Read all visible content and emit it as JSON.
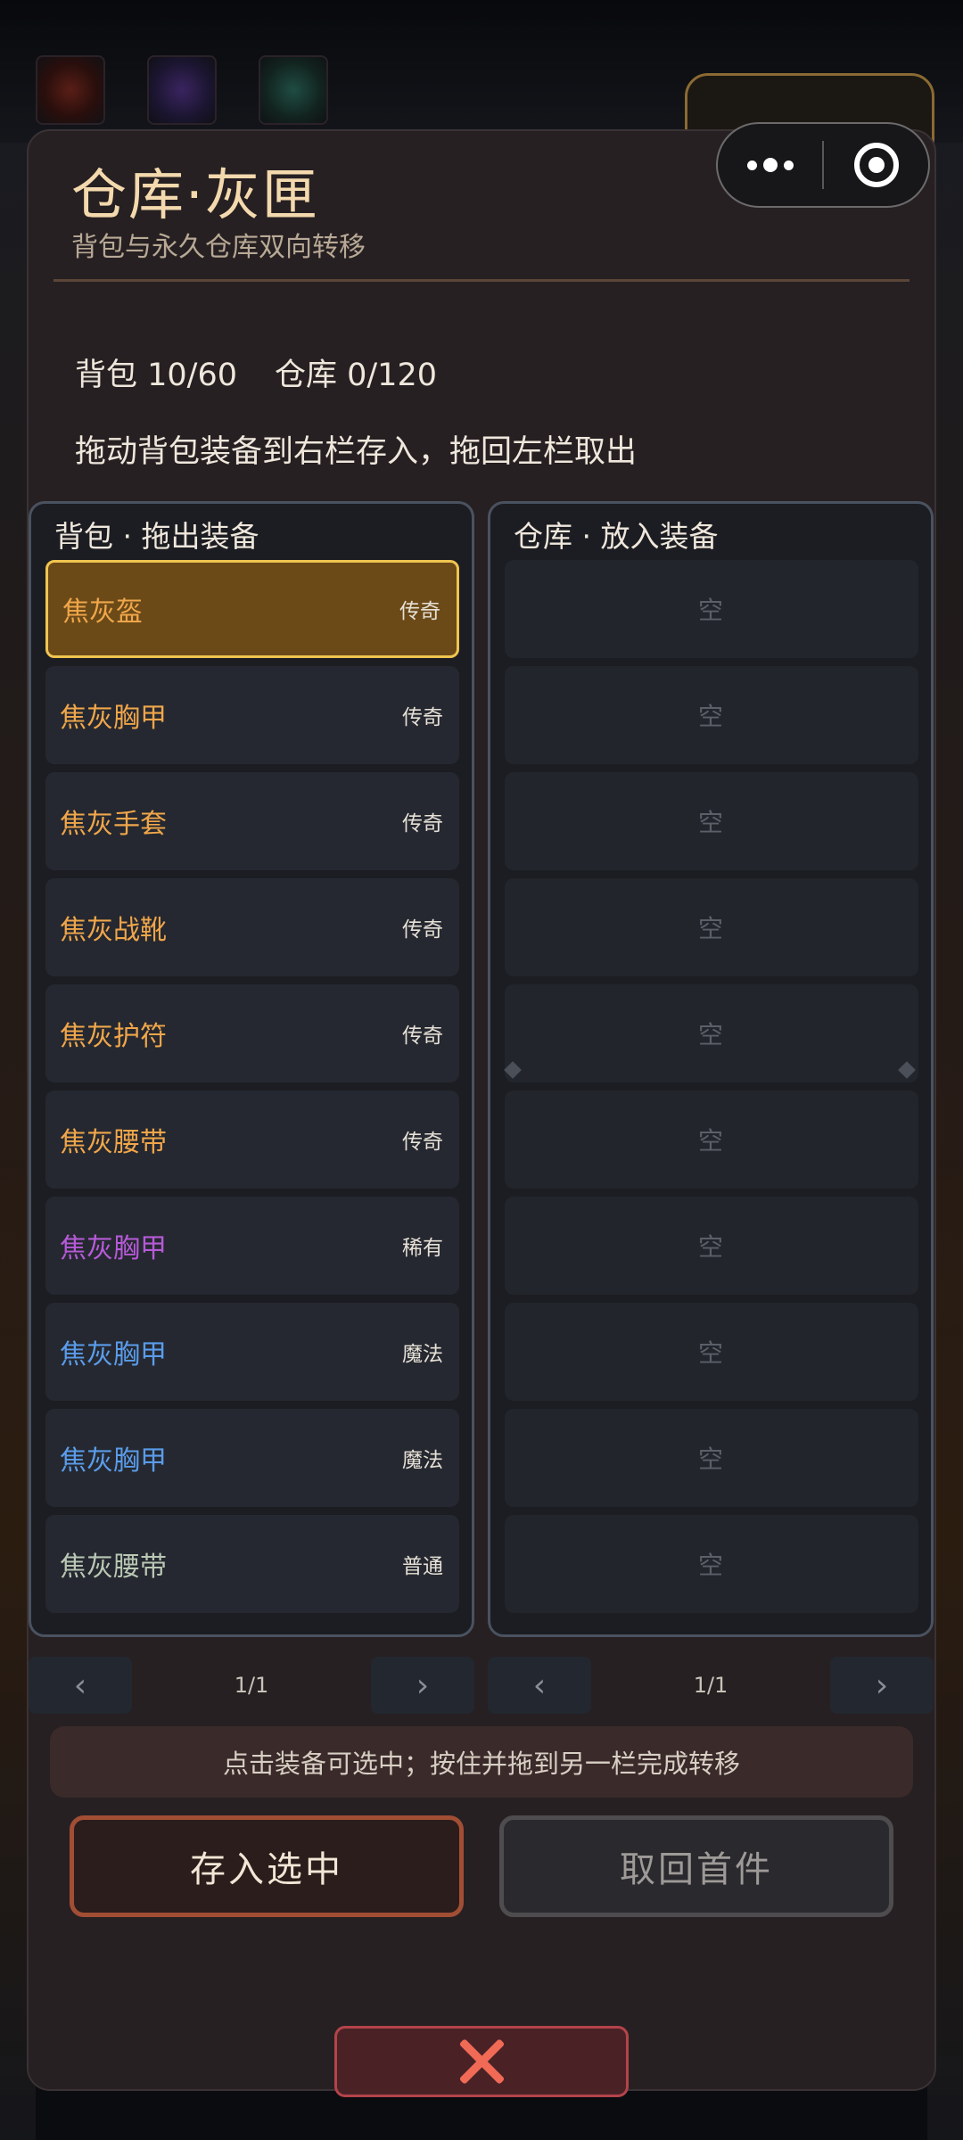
{
  "colors": {
    "legendary": "#f0a64a",
    "rare": "#b65ad8",
    "magic": "#5a9cea",
    "common": "#b9c7b4",
    "accent_border": "#f0c550"
  },
  "dialog": {
    "title": "仓库·灰匣",
    "subtitle": "背包与永久仓库双向转移",
    "backpack_count": "背包 10/60",
    "warehouse_count": "仓库 0/120",
    "instruction": "拖动背包装备到右栏存入，拖回左栏取出"
  },
  "backpack": {
    "header": "背包 · 拖出装备",
    "items": [
      {
        "name": "焦灰盔",
        "rarity": "传奇",
        "tier": "legendary",
        "selected": true
      },
      {
        "name": "焦灰胸甲",
        "rarity": "传奇",
        "tier": "legendary"
      },
      {
        "name": "焦灰手套",
        "rarity": "传奇",
        "tier": "legendary"
      },
      {
        "name": "焦灰战靴",
        "rarity": "传奇",
        "tier": "legendary"
      },
      {
        "name": "焦灰护符",
        "rarity": "传奇",
        "tier": "legendary"
      },
      {
        "name": "焦灰腰带",
        "rarity": "传奇",
        "tier": "legendary"
      },
      {
        "name": "焦灰胸甲",
        "rarity": "稀有",
        "tier": "rare"
      },
      {
        "name": "焦灰胸甲",
        "rarity": "魔法",
        "tier": "magic"
      },
      {
        "name": "焦灰胸甲",
        "rarity": "魔法",
        "tier": "magic"
      },
      {
        "name": "焦灰腰带",
        "rarity": "普通",
        "tier": "common"
      }
    ],
    "page": "1/1",
    "prev": "‹",
    "next": "›"
  },
  "warehouse": {
    "header": "仓库 · 放入装备",
    "empty_label": "空",
    "slot_count": 10,
    "page": "1/1",
    "prev": "‹",
    "next": "›"
  },
  "tip": "点击装备可选中；按住并拖到另一栏完成转移",
  "actions": {
    "deposit": "存入选中",
    "withdraw": "取回首件"
  },
  "icons": {
    "more": "more-dots-icon",
    "target": "target-icon",
    "close": "close-icon"
  }
}
